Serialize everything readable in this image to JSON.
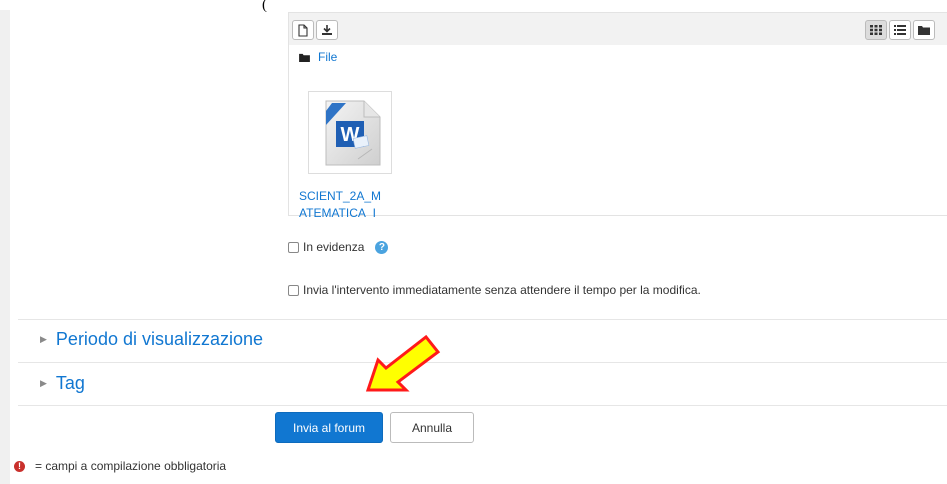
{
  "header_cut_text": "(",
  "file_manager": {
    "folder_label": "File",
    "file_name_line1": "SCIENT_2A_M",
    "file_name_line2": "ATEMATICA_I"
  },
  "options": {
    "highlight_label": "In evidenza",
    "send_now_label": "Invia l'intervento immediatamente senza attendere il tempo per la modifica."
  },
  "sections": {
    "display_period": "Periodo di visualizzazione",
    "tags": "Tag"
  },
  "actions": {
    "submit_label": "Invia al forum",
    "cancel_label": "Annulla"
  },
  "footer": {
    "required_note": "= campi a compilazione obbligatoria"
  },
  "icons": [
    "file-new-icon",
    "download-icon",
    "grid-view-icon",
    "list-view-icon",
    "folder-view-icon",
    "folder-icon",
    "word-doc-icon",
    "help-icon",
    "required-icon",
    "arrow-annotation-icon"
  ],
  "colors": {
    "link": "#1177d1",
    "primary_button": "#1177d1",
    "required": "#c9302c",
    "annotation_arrow": "#ffff00"
  }
}
